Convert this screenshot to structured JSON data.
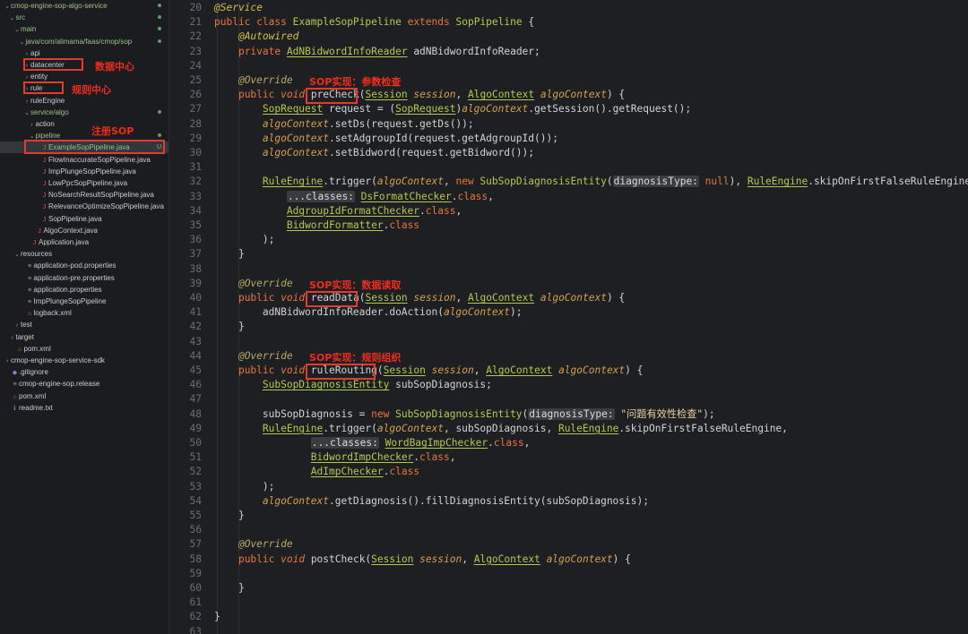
{
  "tree": [
    {
      "label": "cmop-engine-sop-algo-service",
      "indent": 0,
      "chev": "⌄",
      "icon": "",
      "color": "g",
      "dot": true
    },
    {
      "label": "src",
      "indent": 1,
      "chev": "⌄",
      "icon": "",
      "color": "g",
      "dot": true
    },
    {
      "label": "main",
      "indent": 2,
      "chev": "⌄",
      "icon": "",
      "color": "g",
      "dot": true
    },
    {
      "label": "java/com/alimama/faas/cmop/sop",
      "indent": 3,
      "chev": "⌄",
      "icon": "",
      "color": "g",
      "dot": true
    },
    {
      "label": "api",
      "indent": 4,
      "chev": "›",
      "icon": "",
      "color": ""
    },
    {
      "label": "datacenter",
      "indent": 4,
      "chev": "›",
      "icon": "",
      "color": ""
    },
    {
      "label": "entity",
      "indent": 4,
      "chev": "›",
      "icon": "",
      "color": ""
    },
    {
      "label": "rule",
      "indent": 4,
      "chev": "›",
      "icon": "",
      "color": ""
    },
    {
      "label": "ruleEngine",
      "indent": 4,
      "chev": "›",
      "icon": "",
      "color": ""
    },
    {
      "label": "service/algo",
      "indent": 4,
      "chev": "⌄",
      "icon": "",
      "color": "g",
      "dot": true
    },
    {
      "label": "action",
      "indent": 5,
      "chev": "›",
      "icon": "",
      "color": ""
    },
    {
      "label": "pipeline",
      "indent": 5,
      "chev": "⌄",
      "icon": "",
      "color": "g",
      "dot": true
    },
    {
      "label": "ExampleSopPipeline.java",
      "indent": 6,
      "chev": "",
      "icon": "J",
      "color": "g",
      "mark": "U",
      "sel": true
    },
    {
      "label": "FlowInaccurateSopPipeline.java",
      "indent": 6,
      "chev": "",
      "icon": "J",
      "color": ""
    },
    {
      "label": "ImpPlungeSopPipeline.java",
      "indent": 6,
      "chev": "",
      "icon": "J",
      "color": ""
    },
    {
      "label": "LowPpcSopPipeline.java",
      "indent": 6,
      "chev": "",
      "icon": "J",
      "color": ""
    },
    {
      "label": "NoSearchResultSopPipeline.java",
      "indent": 6,
      "chev": "",
      "icon": "J",
      "color": ""
    },
    {
      "label": "RelevanceOptimizeSopPipeline.java",
      "indent": 6,
      "chev": "",
      "icon": "J",
      "color": ""
    },
    {
      "label": "SopPipeline.java",
      "indent": 6,
      "chev": "",
      "icon": "J",
      "color": ""
    },
    {
      "label": "AlgoContext.java",
      "indent": 5,
      "chev": "",
      "icon": "J",
      "color": ""
    },
    {
      "label": "Application.java",
      "indent": 4,
      "chev": "",
      "icon": "J",
      "color": ""
    },
    {
      "label": "resources",
      "indent": 2,
      "chev": "⌄",
      "icon": "",
      "color": ""
    },
    {
      "label": "application-pod.properties",
      "indent": 3,
      "chev": "",
      "icon": "≡",
      "color": ""
    },
    {
      "label": "application-pre.properties",
      "indent": 3,
      "chev": "",
      "icon": "≡",
      "color": ""
    },
    {
      "label": "application.properties",
      "indent": 3,
      "chev": "",
      "icon": "≡",
      "color": ""
    },
    {
      "label": "ImpPlungeSopPipeline",
      "indent": 3,
      "chev": "",
      "icon": "≡",
      "color": ""
    },
    {
      "label": "logback.xml",
      "indent": 3,
      "chev": "",
      "icon": "⌂",
      "color": ""
    },
    {
      "label": "test",
      "indent": 2,
      "chev": "›",
      "icon": "",
      "color": ""
    },
    {
      "label": "target",
      "indent": 1,
      "chev": "›",
      "icon": "",
      "color": ""
    },
    {
      "label": "pom.xml",
      "indent": 1,
      "chev": "",
      "icon": "⌂",
      "color": ""
    },
    {
      "label": "cmop-engine-sop-service-sdk",
      "indent": 0,
      "chev": "›",
      "icon": "",
      "color": ""
    },
    {
      "label": ".gitignore",
      "indent": 0,
      "chev": "",
      "icon": "◆",
      "color": ""
    },
    {
      "label": "cmop-engine-sop.release",
      "indent": 0,
      "chev": "",
      "icon": "≡",
      "color": ""
    },
    {
      "label": "pom.xml",
      "indent": 0,
      "chev": "",
      "icon": "⌂",
      "color": ""
    },
    {
      "label": "readme.txt",
      "indent": 0,
      "chev": "",
      "icon": "ℹ",
      "color": ""
    }
  ],
  "tree_labels": {
    "datacenter": "数据中心",
    "rule": "规则中心",
    "pipeline": "注册SOP"
  },
  "code_labels": {
    "precheck": "SOP实现：参数检查",
    "readdata": "SOP实现：数据读取",
    "rulerouting": "SOP实现：规则组织"
  },
  "code": [
    {
      "n": "20",
      "html": "<span class='ann'>@Service</span>"
    },
    {
      "n": "21",
      "html": "<span class='kw'>public class</span> <span class='clsn'>ExampleSopPipeline</span> <span class='kw'>extends</span> <span class='clsn'>SopPipeline</span> {"
    },
    {
      "n": "22",
      "html": "    <span class='ann'>@Autowired</span>"
    },
    {
      "n": "23",
      "html": "    <span class='kw'>private</span> <span class='cls'>AdNBidwordInfoReader</span> adNBidwordInfoReader;"
    },
    {
      "n": "24",
      "html": ""
    },
    {
      "n": "25",
      "html": "    <span class='ann2'>@Override</span>"
    },
    {
      "n": "26",
      "html": "    <span class='kw'>public</span> <span class='kwi'>void</span> <span class='fn'>preCheck</span>(<span class='cls'>Session</span> <span class='par'>session</span>, <span class='cls'>AlgoContext</span> <span class='par'>algoContext</span>) {"
    },
    {
      "n": "27",
      "html": "        <span class='cls'>SopRequest</span> request = (<span class='cls'>SopRequest</span>)<span class='par'>algoContext</span>.getSession().getRequest();"
    },
    {
      "n": "28",
      "html": "        <span class='par'>algoContext</span>.setDs(request.getDs());"
    },
    {
      "n": "29",
      "html": "        <span class='par'>algoContext</span>.setAdgroupId(request.getAdgroupId());"
    },
    {
      "n": "30",
      "html": "        <span class='par'>algoContext</span>.setBidword(request.getBidword());"
    },
    {
      "n": "31",
      "html": ""
    },
    {
      "n": "32",
      "html": "        <span class='cls'>RuleEngine</span>.trigger(<span class='par'>algoContext</span>, <span class='kw'>new</span> <span class='clsn'>SubSopDiagnosisEntity</span>(<span class='hint'>diagnosisType:</span> <span class='kw'>null</span>), <span class='cls'>RuleEngine</span>.skipOnFirstFalseRuleEngine,"
    },
    {
      "n": "33",
      "html": "            <span class='hint'>...classes:</span> <span class='cls'>DsFormatChecker</span>.<span class='kw'>class</span>,"
    },
    {
      "n": "34",
      "html": "            <span class='cls'>AdgroupIdFormatChecker</span>.<span class='kw'>class</span>,"
    },
    {
      "n": "35",
      "html": "            <span class='cls'>BidwordFormatter</span>.<span class='kw'>class</span>"
    },
    {
      "n": "36",
      "html": "        );"
    },
    {
      "n": "37",
      "html": "    }"
    },
    {
      "n": "38",
      "html": ""
    },
    {
      "n": "39",
      "html": "    <span class='ann2'>@Override</span>"
    },
    {
      "n": "40",
      "html": "    <span class='kw'>public</span> <span class='kwi'>void</span> <span class='fn'>readData</span>(<span class='cls'>Session</span> <span class='par'>session</span>, <span class='cls'>AlgoContext</span> <span class='par'>algoContext</span>) {"
    },
    {
      "n": "41",
      "html": "        adNBidwordInfoReader.doAction(<span class='par'>algoContext</span>);"
    },
    {
      "n": "42",
      "html": "    }"
    },
    {
      "n": "43",
      "html": ""
    },
    {
      "n": "44",
      "html": "    <span class='ann2'>@Override</span>"
    },
    {
      "n": "45",
      "html": "    <span class='kw'>public</span> <span class='kwi'>void</span> <span class='fn'>ruleRouting</span>(<span class='cls'>Session</span> <span class='par'>session</span>, <span class='cls'>AlgoContext</span> <span class='par'>algoContext</span>) {"
    },
    {
      "n": "46",
      "html": "        <span class='cls'>SubSopDiagnosisEntity</span> subSopDiagnosis;"
    },
    {
      "n": "47",
      "html": ""
    },
    {
      "n": "48",
      "html": "        subSopDiagnosis = <span class='kw'>new</span> <span class='clsn'>SubSopDiagnosisEntity</span>(<span class='hint'>diagnosisType:</span> <span class='str'>\"问题有效性检查\"</span>);"
    },
    {
      "n": "49",
      "html": "        <span class='cls'>RuleEngine</span>.trigger(<span class='par'>algoContext</span>, subSopDiagnosis, <span class='cls'>RuleEngine</span>.skipOnFirstFalseRuleEngine,"
    },
    {
      "n": "50",
      "html": "                <span class='hint'>...classes:</span> <span class='cls'>WordBagImpChecker</span>.<span class='kw'>class</span>,"
    },
    {
      "n": "51",
      "html": "                <span class='cls'>BidwordImpChecker</span>.<span class='kw'>class</span>,"
    },
    {
      "n": "52",
      "html": "                <span class='cls'>AdImpChecker</span>.<span class='kw'>class</span>"
    },
    {
      "n": "53",
      "html": "        );"
    },
    {
      "n": "54",
      "html": "        <span class='par'>algoContext</span>.getDiagnosis().fillDiagnosisEntity(subSopDiagnosis);"
    },
    {
      "n": "55",
      "html": "    }"
    },
    {
      "n": "56",
      "html": ""
    },
    {
      "n": "57",
      "html": "    <span class='ann2'>@Override</span>"
    },
    {
      "n": "58",
      "html": "    <span class='kw'>public</span> <span class='kwi'>void</span> postCheck(<span class='cls'>Session</span> <span class='par'>session</span>, <span class='cls'>AlgoContext</span> <span class='par'>algoContext</span>) {"
    },
    {
      "n": "59",
      "html": ""
    },
    {
      "n": "60",
      "html": "    }"
    },
    {
      "n": "61",
      "html": ""
    },
    {
      "n": "62",
      "html": "}"
    },
    {
      "n": "63",
      "html": ""
    }
  ]
}
